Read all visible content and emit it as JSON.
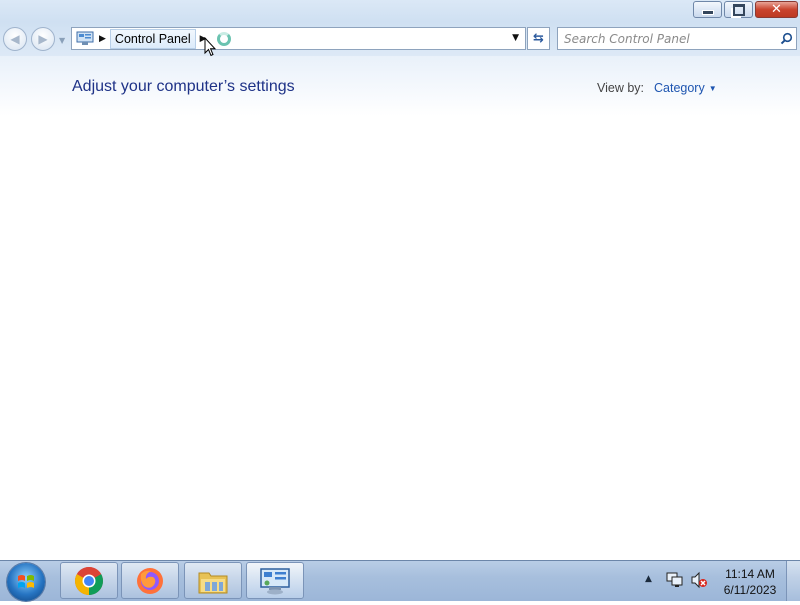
{
  "window": {
    "caption_buttons": [
      "minimize",
      "restore",
      "close"
    ]
  },
  "navigation": {
    "back_icon": "back-arrow-icon",
    "forward_icon": "forward-arrow-icon",
    "breadcrumb": [
      "Control Panel"
    ],
    "search_placeholder": "Search Control Panel"
  },
  "main": {
    "title": "Adjust your computer’s settings",
    "view_by_label": "View by:",
    "view_by_value": "Category"
  },
  "taskbar": {
    "pinned": [
      {
        "name": "chrome",
        "icon": "chrome-icon"
      },
      {
        "name": "firefox",
        "icon": "firefox-icon"
      },
      {
        "name": "file-explorer",
        "icon": "folder-icon"
      },
      {
        "name": "control-panel",
        "icon": "control-panel-icon",
        "active": true
      }
    ],
    "tray_icons": [
      "show-hidden-icons-arrow",
      "network-icon",
      "volume-muted-icon"
    ],
    "time": "11:14 AM",
    "date": "6/11/2023"
  },
  "colors": {
    "title": "#1e3287",
    "link": "#1e55b0"
  }
}
